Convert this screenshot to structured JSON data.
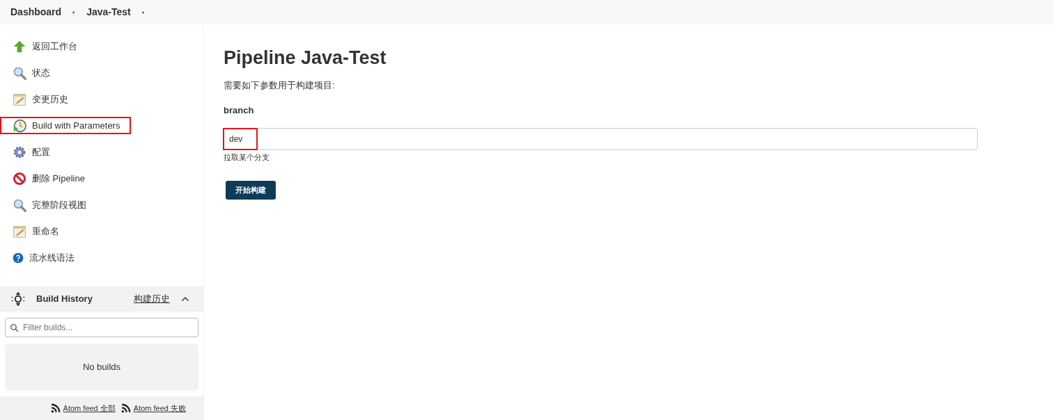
{
  "breadcrumbs": [
    {
      "label": "Dashboard"
    },
    {
      "label": "Java-Test"
    }
  ],
  "sidebar": {
    "items": [
      {
        "label": "返回工作台",
        "kind": "up",
        "highlighted": false
      },
      {
        "label": "状态",
        "kind": "search",
        "highlighted": false
      },
      {
        "label": "变更历史",
        "kind": "notepad",
        "highlighted": false
      },
      {
        "label": "Build with Parameters",
        "kind": "build",
        "highlighted": true
      },
      {
        "label": "配置",
        "kind": "gear",
        "highlighted": false
      },
      {
        "label": "删除 Pipeline",
        "kind": "delete",
        "highlighted": false
      },
      {
        "label": "完整阶段视图",
        "kind": "search",
        "highlighted": false
      },
      {
        "label": "重命名",
        "kind": "notepad",
        "highlighted": false
      },
      {
        "label": "流水线语法",
        "kind": "help",
        "highlighted": false
      }
    ]
  },
  "build_history": {
    "title": "Build History",
    "link": "构建历史",
    "expanded": true,
    "filter": {
      "placeholder": "Filter builds..."
    },
    "empty_text": "No builds",
    "feeds": [
      {
        "label": "Atom feed 全部"
      },
      {
        "label": "Atom feed 失败"
      }
    ]
  },
  "main": {
    "title": "Pipeline Java-Test",
    "description": "需要如下参数用于构建项目:",
    "parameters": [
      {
        "name": "branch",
        "value": "dev",
        "help": "拉取某个分支",
        "highlighted": true
      }
    ],
    "submit": "开始构建"
  }
}
